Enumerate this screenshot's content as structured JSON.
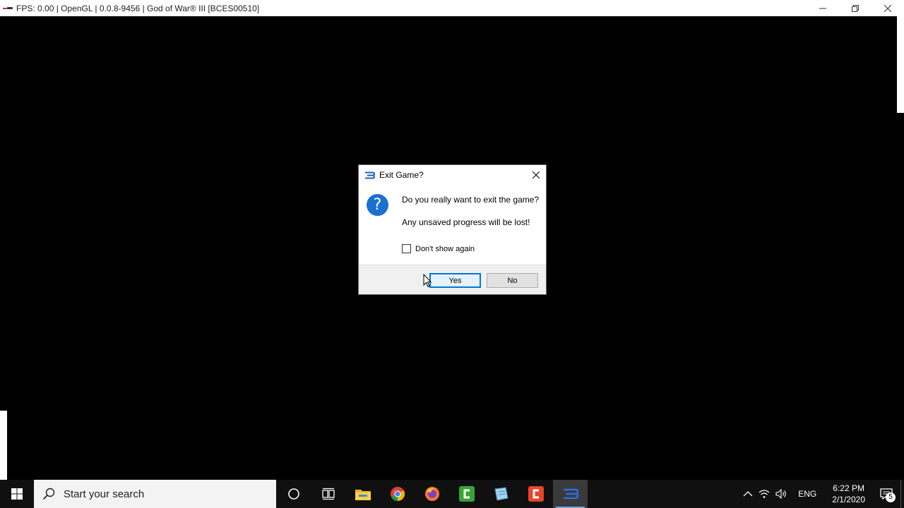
{
  "window": {
    "title": "FPS: 0.00 | OpenGL | 0.0.8-9456 | God of War® III [BCES00510]"
  },
  "dialog": {
    "title": "Exit Game?",
    "message": "Do you really want to exit the game?",
    "detail": "Any unsaved progress will be lost!",
    "checkbox_label": "Don't show again",
    "checkbox_checked": false,
    "yes_label": "Yes",
    "no_label": "No"
  },
  "taskbar": {
    "search_placeholder": "Start your search",
    "language": "ENG",
    "time": "6:22 PM",
    "date": "2/1/2020",
    "notification_count": "5",
    "pinned": [
      {
        "name": "cortana-icon"
      },
      {
        "name": "task-view-icon"
      },
      {
        "name": "file-explorer-icon"
      },
      {
        "name": "chrome-icon"
      },
      {
        "name": "firefox-icon"
      },
      {
        "name": "camtasia-icon"
      },
      {
        "name": "notepad-icon"
      },
      {
        "name": "recorder-icon"
      },
      {
        "name": "rpcs3-icon"
      }
    ]
  },
  "colors": {
    "accent": "#0078d7",
    "question_icon": "#1a6fd1",
    "taskbar": "#101010"
  }
}
